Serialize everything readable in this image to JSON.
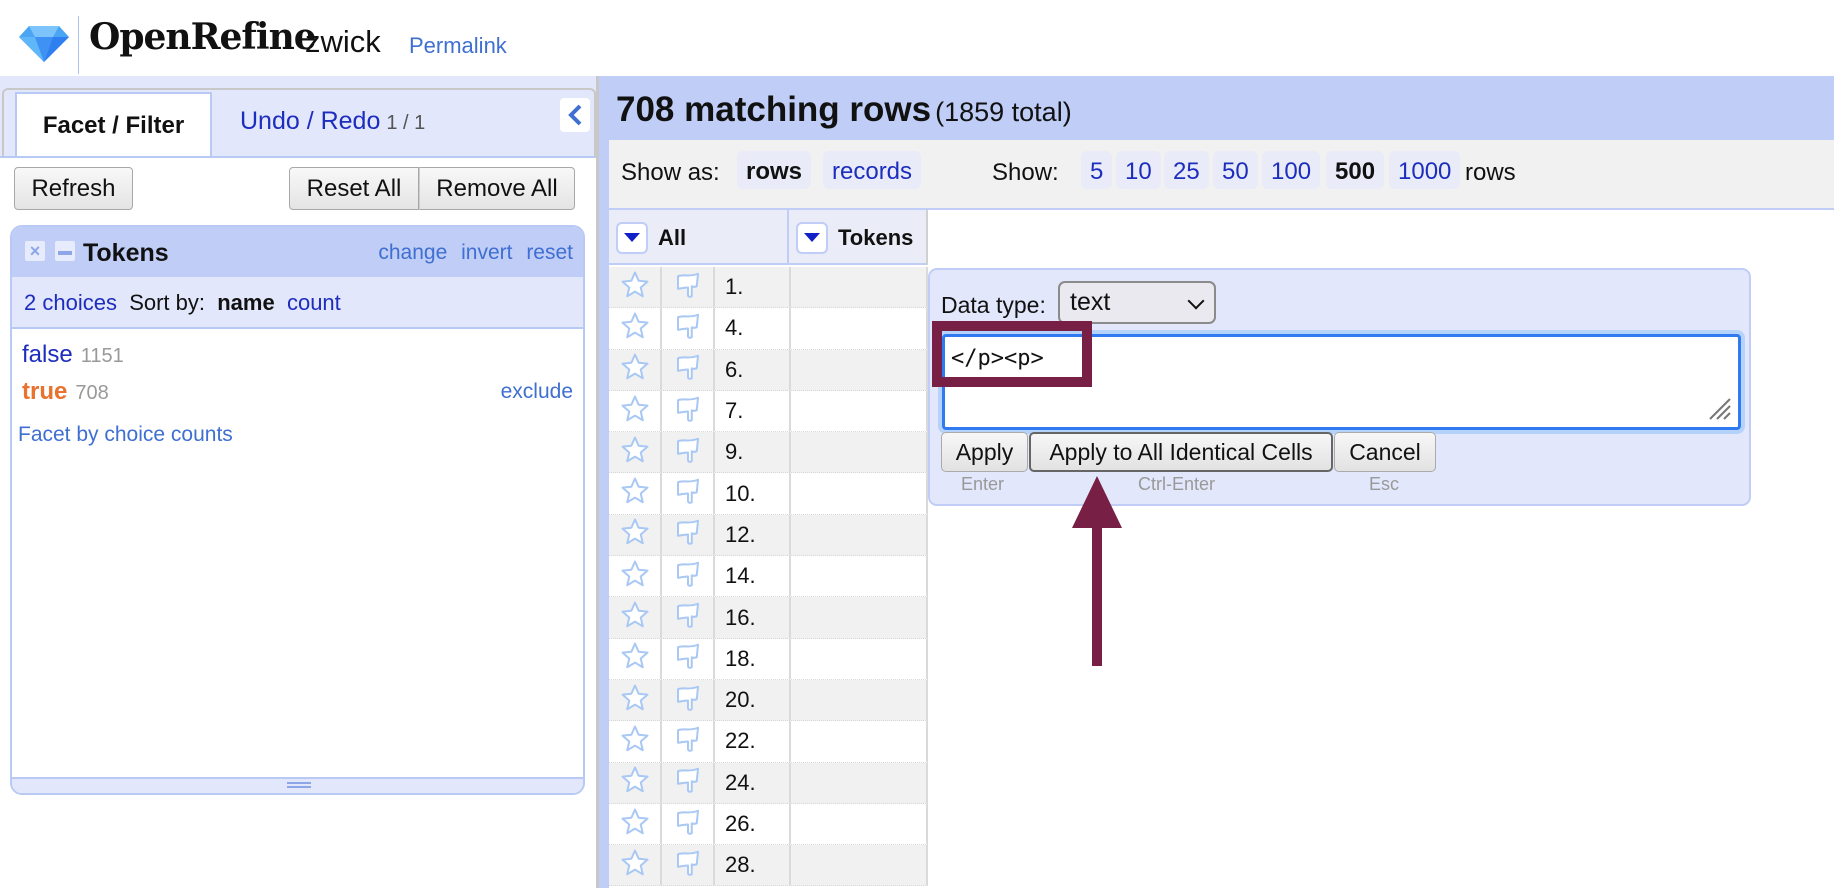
{
  "header": {
    "app_name": "OpenRefine",
    "project_name": "zwick",
    "permalink_label": "Permalink",
    "logo_icon": "diamond-icon"
  },
  "left_panel": {
    "tabs": [
      {
        "label": "Facet / Filter",
        "active": true
      },
      {
        "label": "Undo / Redo",
        "count": "1 / 1",
        "active": false
      }
    ],
    "collapse_icon": "chevron-left-icon",
    "buttons": {
      "refresh": "Refresh",
      "reset_all": "Reset All",
      "remove_all": "Remove All"
    },
    "facet": {
      "title": "Tokens",
      "links": [
        "change",
        "invert",
        "reset"
      ],
      "choices_count_label": "2 choices",
      "sort_by_label": "Sort by:",
      "sort_options": [
        {
          "label": "name",
          "selected": true
        },
        {
          "label": "count",
          "selected": false
        }
      ],
      "choices": [
        {
          "label": "false",
          "count": "1151",
          "selected": false
        },
        {
          "label": "true",
          "count": "708",
          "selected": true,
          "action": "exclude"
        }
      ],
      "facet_by_counts_label": "Facet by choice counts"
    }
  },
  "main": {
    "summary": {
      "matching": "708 matching rows",
      "total": "(1859 total)"
    },
    "view_bar": {
      "show_as_label": "Show as:",
      "show_as_options": [
        {
          "label": "rows",
          "selected": true
        },
        {
          "label": "records",
          "selected": false
        }
      ],
      "show_label": "Show:",
      "page_sizes": [
        {
          "label": "5",
          "selected": false
        },
        {
          "label": "10",
          "selected": false
        },
        {
          "label": "25",
          "selected": false
        },
        {
          "label": "50",
          "selected": false
        },
        {
          "label": "100",
          "selected": false
        },
        {
          "label": "500",
          "selected": true
        },
        {
          "label": "1000",
          "selected": false
        }
      ],
      "rows_suffix": "rows"
    },
    "table": {
      "columns": [
        {
          "label": "All"
        },
        {
          "label": "Tokens"
        }
      ],
      "rows": [
        {
          "index": "1.",
          "tokens": ""
        },
        {
          "index": "4.",
          "tokens": ""
        },
        {
          "index": "6.",
          "tokens": ""
        },
        {
          "index": "7.",
          "tokens": ""
        },
        {
          "index": "9.",
          "tokens": ""
        },
        {
          "index": "10.",
          "tokens": ""
        },
        {
          "index": "12.",
          "tokens": ""
        },
        {
          "index": "14.",
          "tokens": ""
        },
        {
          "index": "16.",
          "tokens": ""
        },
        {
          "index": "18.",
          "tokens": ""
        },
        {
          "index": "20.",
          "tokens": ""
        },
        {
          "index": "22.",
          "tokens": ""
        },
        {
          "index": "24.",
          "tokens": ""
        },
        {
          "index": "26.",
          "tokens": ""
        },
        {
          "index": "28.",
          "tokens": ""
        }
      ]
    }
  },
  "cell_editor": {
    "data_type_label": "Data type:",
    "data_type_value": "text",
    "value": "</p><p>",
    "buttons": [
      {
        "label": "Apply",
        "hint": "Enter"
      },
      {
        "label": "Apply to All Identical Cells",
        "hint": "Ctrl-Enter"
      },
      {
        "label": "Cancel",
        "hint": "Esc"
      }
    ]
  },
  "annotation": {
    "color": "#771f44",
    "highlight_target": "cell-editor-value",
    "arrow_target": "apply-to-all-identical-cells-button"
  }
}
